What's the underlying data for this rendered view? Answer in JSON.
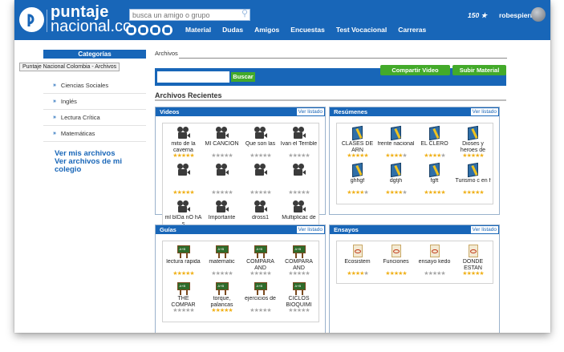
{
  "header": {
    "logo_line1": "puntaje",
    "logo_line2": "nacional.co",
    "search_placeholder": "busca un amigo o grupo",
    "nav": [
      "Material",
      "Dudas",
      "Amigos",
      "Encuestas",
      "Test Vocacional",
      "Carreras"
    ],
    "user_points": "150 ★",
    "user_name": "robespierre",
    "nav_icons": [
      "circle-icon",
      "face-icon",
      "camera-icon",
      "megaphone-icon"
    ]
  },
  "sidebar": {
    "title": "Categorías",
    "tooltip": "Puntaje Nacional Colombia - Archivos",
    "items": [
      "Ciencias Sociales",
      "Inglés",
      "Lectura Crítica",
      "Matemáticas"
    ],
    "links": [
      "Ver mis archivos",
      "Ver archivos de mi colegio"
    ]
  },
  "main": {
    "title": "Archivos",
    "share_button": "Compartir Video",
    "upload_button": "Subir Material",
    "search_button": "Buscar",
    "recent_title": "Archivos Recientes"
  },
  "panels": [
    {
      "title": "Videos",
      "link": "Ver listado",
      "icon": "film-camera-icon",
      "items": [
        {
          "caption": "mito de la caverna",
          "rating": 5
        },
        {
          "caption": "MI CANCION",
          "rating": 0
        },
        {
          "caption": "Que son las",
          "rating": 0
        },
        {
          "caption": "Ivan el Terrible",
          "rating": 0
        },
        {
          "caption": "",
          "rating": 5
        },
        {
          "caption": "",
          "rating": 0
        },
        {
          "caption": "",
          "rating": 0
        },
        {
          "caption": "",
          "rating": 0
        },
        {
          "caption": "ml bIDa nO hA s",
          "rating": 0
        },
        {
          "caption": "Importante",
          "rating": 0
        },
        {
          "caption": "dross1",
          "rating": 0
        },
        {
          "caption": "Multiplicac de",
          "rating": 0
        }
      ]
    },
    {
      "title": "Resúmenes",
      "link": "Ver listado",
      "icon": "book-icon",
      "items": [
        {
          "caption": "CLASES DE ARN",
          "rating": 5
        },
        {
          "caption": "frente nacional",
          "rating": 4
        },
        {
          "caption": "EL CLERO",
          "rating": 4
        },
        {
          "caption": "Dioses y heroes de",
          "rating": 5
        },
        {
          "caption": "ghhgf",
          "rating": 4
        },
        {
          "caption": "dgtjh",
          "rating": 4
        },
        {
          "caption": "fgft",
          "rating": 5
        },
        {
          "caption": "Turismo c en f",
          "rating": 5
        }
      ]
    },
    {
      "title": "Guías",
      "link": "Ver listado",
      "icon": "chalkboard-icon",
      "items": [
        {
          "caption": "lectura rapida",
          "rating": 5
        },
        {
          "caption": "matematic",
          "rating": 0
        },
        {
          "caption": "COMPARA AND",
          "rating": 0
        },
        {
          "caption": "COMPARA AND",
          "rating": 0
        },
        {
          "caption": "THE COMPAR",
          "rating": 0
        },
        {
          "caption": "torque, palancas",
          "rating": 5
        },
        {
          "caption": "ejercicios de",
          "rating": 0
        },
        {
          "caption": "CICLOS BIOQUIMI",
          "rating": 0
        }
      ]
    },
    {
      "title": "Ensayos",
      "link": "Ver listado",
      "icon": "document-icon",
      "items": [
        {
          "caption": "Ecosistem",
          "rating": 4
        },
        {
          "caption": "Funciones",
          "rating": 5
        },
        {
          "caption": "ensayo kedo",
          "rating": 0
        },
        {
          "caption": "DONDE ESTAN",
          "rating": 5
        }
      ]
    }
  ],
  "colors": {
    "primary": "#1866b8",
    "accent_green": "#43aa2a",
    "star": "#f0b11a"
  }
}
